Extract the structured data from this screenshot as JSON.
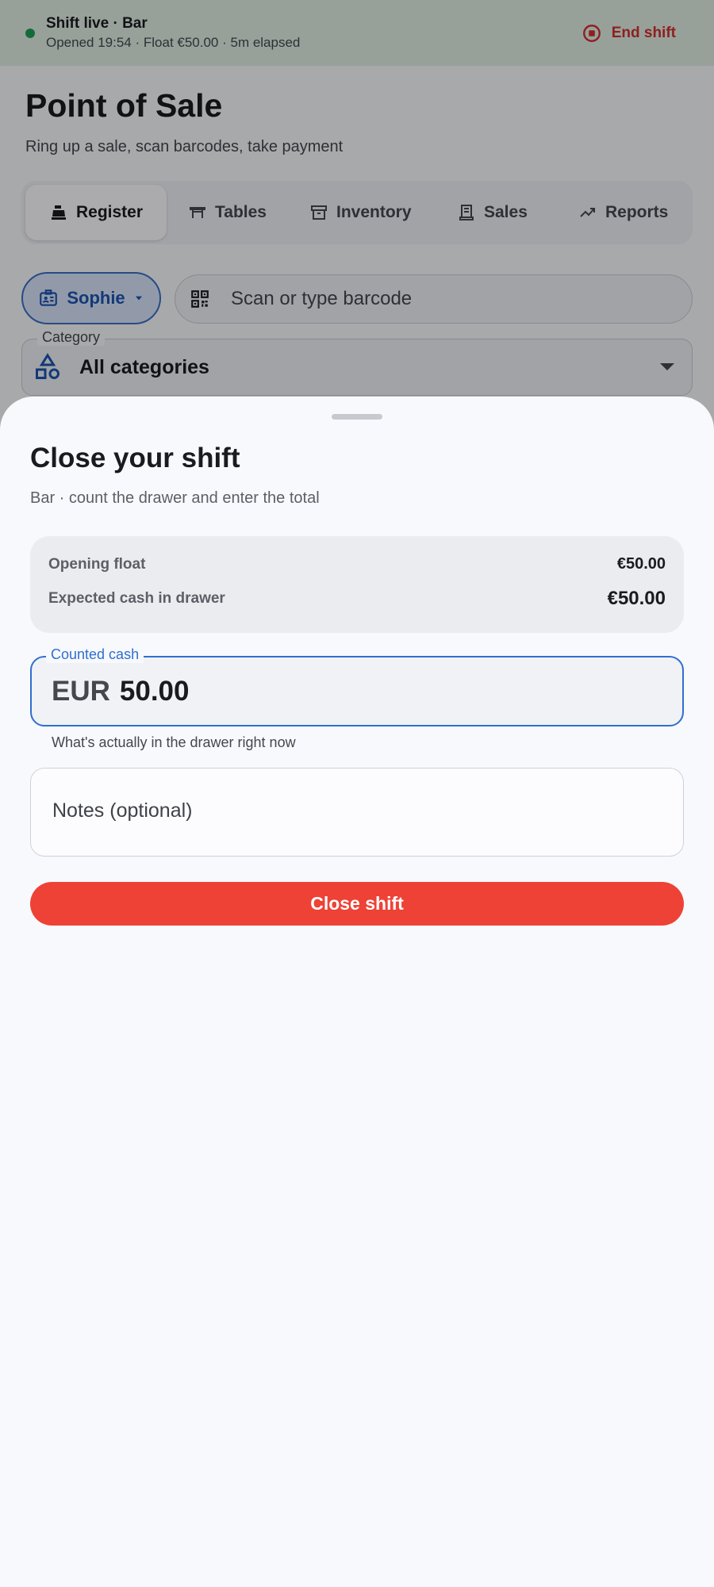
{
  "shift_bar": {
    "title": "Shift live · Bar",
    "subtitle": "Opened 19:54 · Float €50.00 · 5m elapsed",
    "end_label": "End shift",
    "status_color": "#1e9e55",
    "end_color": "#d32f2f"
  },
  "header": {
    "title": "Point of Sale",
    "subtitle": "Ring up a sale, scan barcodes, take payment"
  },
  "tabs": [
    {
      "label": "Register",
      "icon": "cash-register-icon",
      "active": true
    },
    {
      "label": "Tables",
      "icon": "table-icon",
      "active": false
    },
    {
      "label": "Inventory",
      "icon": "archive-icon",
      "active": false
    },
    {
      "label": "Sales",
      "icon": "receipt-icon",
      "active": false
    },
    {
      "label": "Reports",
      "icon": "trending-icon",
      "active": false
    }
  ],
  "staff": {
    "name": "Sophie"
  },
  "barcode": {
    "placeholder": "Scan or type barcode"
  },
  "category": {
    "label": "Category",
    "value": "All categories"
  },
  "sheet": {
    "title": "Close your shift",
    "subtitle": "Bar · count the drawer and enter the total",
    "summary": {
      "opening_label": "Opening float",
      "opening_value": "€50.00",
      "expected_label": "Expected cash in drawer",
      "expected_value": "€50.00"
    },
    "counted": {
      "label": "Counted cash",
      "prefix": "EUR",
      "value": "50.00",
      "helper": "What's actually in the drawer right now"
    },
    "notes": {
      "placeholder": "Notes (optional)"
    },
    "close_label": "Close shift",
    "accent": "#2f6fd0",
    "danger": "#ee4236"
  }
}
